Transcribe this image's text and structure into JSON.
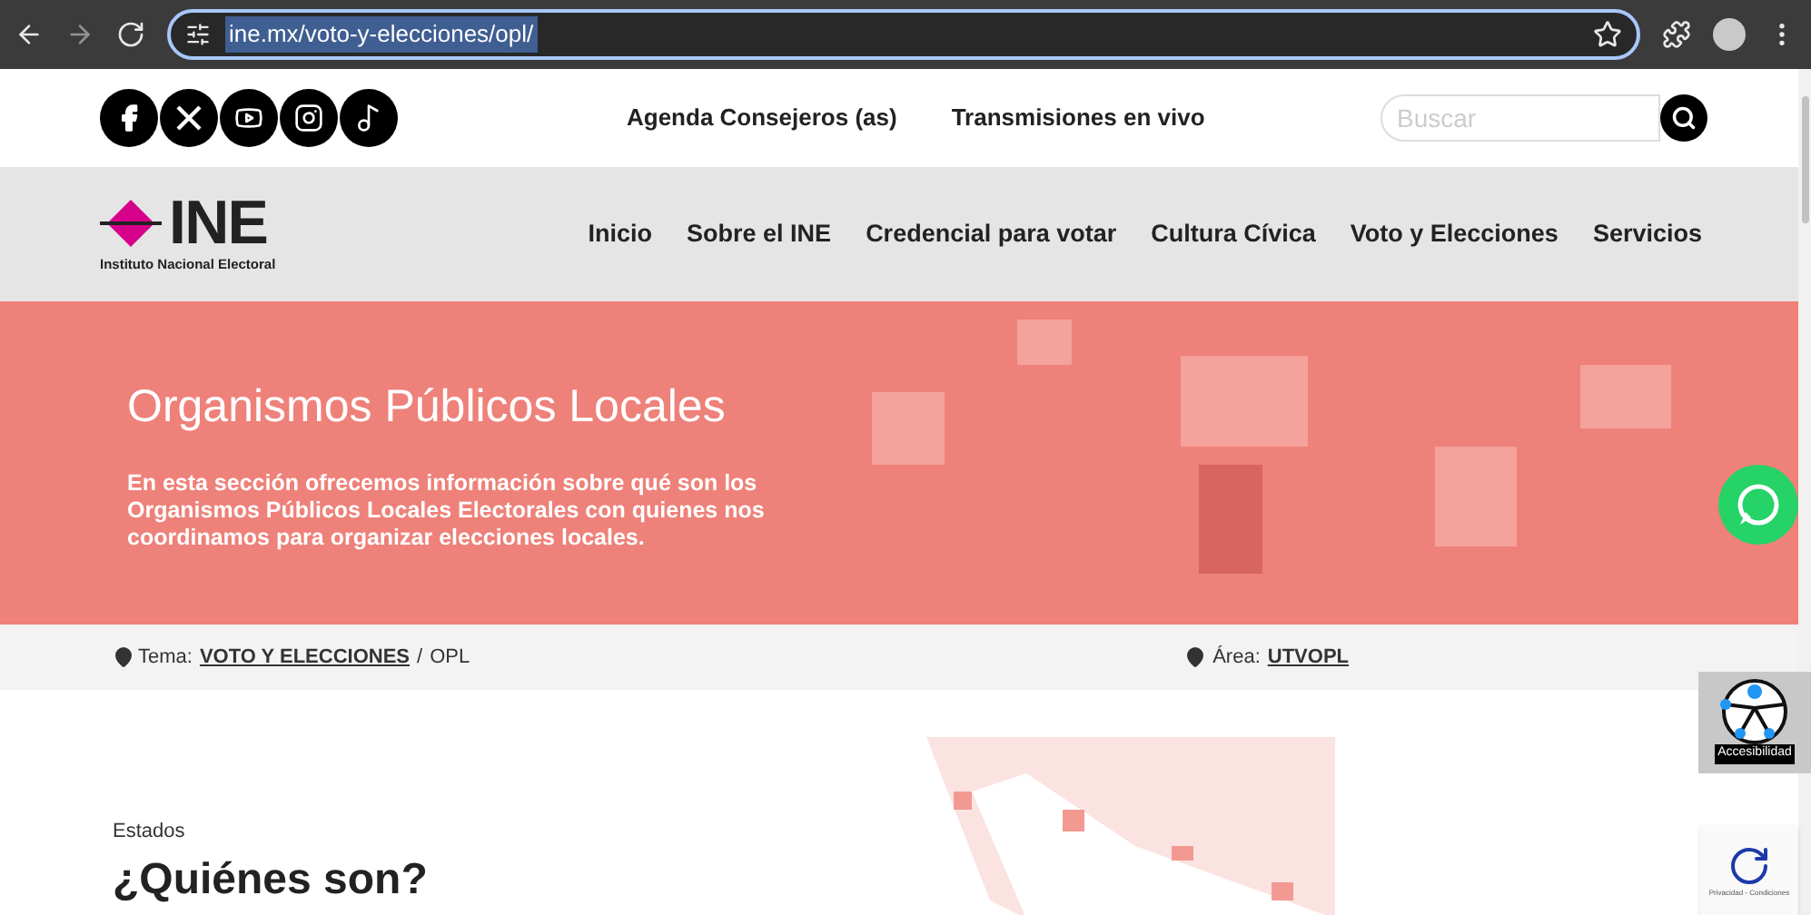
{
  "browser": {
    "url": "ine.mx/voto-y-elecciones/opl/"
  },
  "topbar": {
    "social": [
      {
        "kind": "facebook"
      },
      {
        "kind": "x"
      },
      {
        "kind": "youtube"
      },
      {
        "kind": "instagram"
      },
      {
        "kind": "tiktok"
      }
    ],
    "links": [
      "Agenda Consejeros (as)",
      "Transmisiones en vivo"
    ],
    "search": {
      "placeholder": "Buscar"
    }
  },
  "logo": {
    "name": "INE",
    "subtitle": "Instituto Nacional Electoral"
  },
  "nav": [
    "Inicio",
    "Sobre el INE",
    "Credencial para votar",
    "Cultura Cívica",
    "Voto y Elecciones",
    "Servicios"
  ],
  "hero": {
    "title": "Organismos Públicos Locales",
    "text": "En esta sección ofrecemos información sobre qué son los Organismos Públicos Locales Electorales con quienes nos coordinamos para organizar elecciones locales."
  },
  "breadcrumb": {
    "label": "Tema:",
    "topic": "VOTO Y ELECCIONES",
    "separator": "/",
    "current": "OPL",
    "area_label": "Área:",
    "area": "UTVOPL"
  },
  "section": {
    "eyebrow": "Estados",
    "title": "¿Quiénes son?"
  },
  "accessibility": {
    "label": "Accesibilidad"
  },
  "recaptcha": {
    "text": "Privacidad - Condiciones"
  }
}
